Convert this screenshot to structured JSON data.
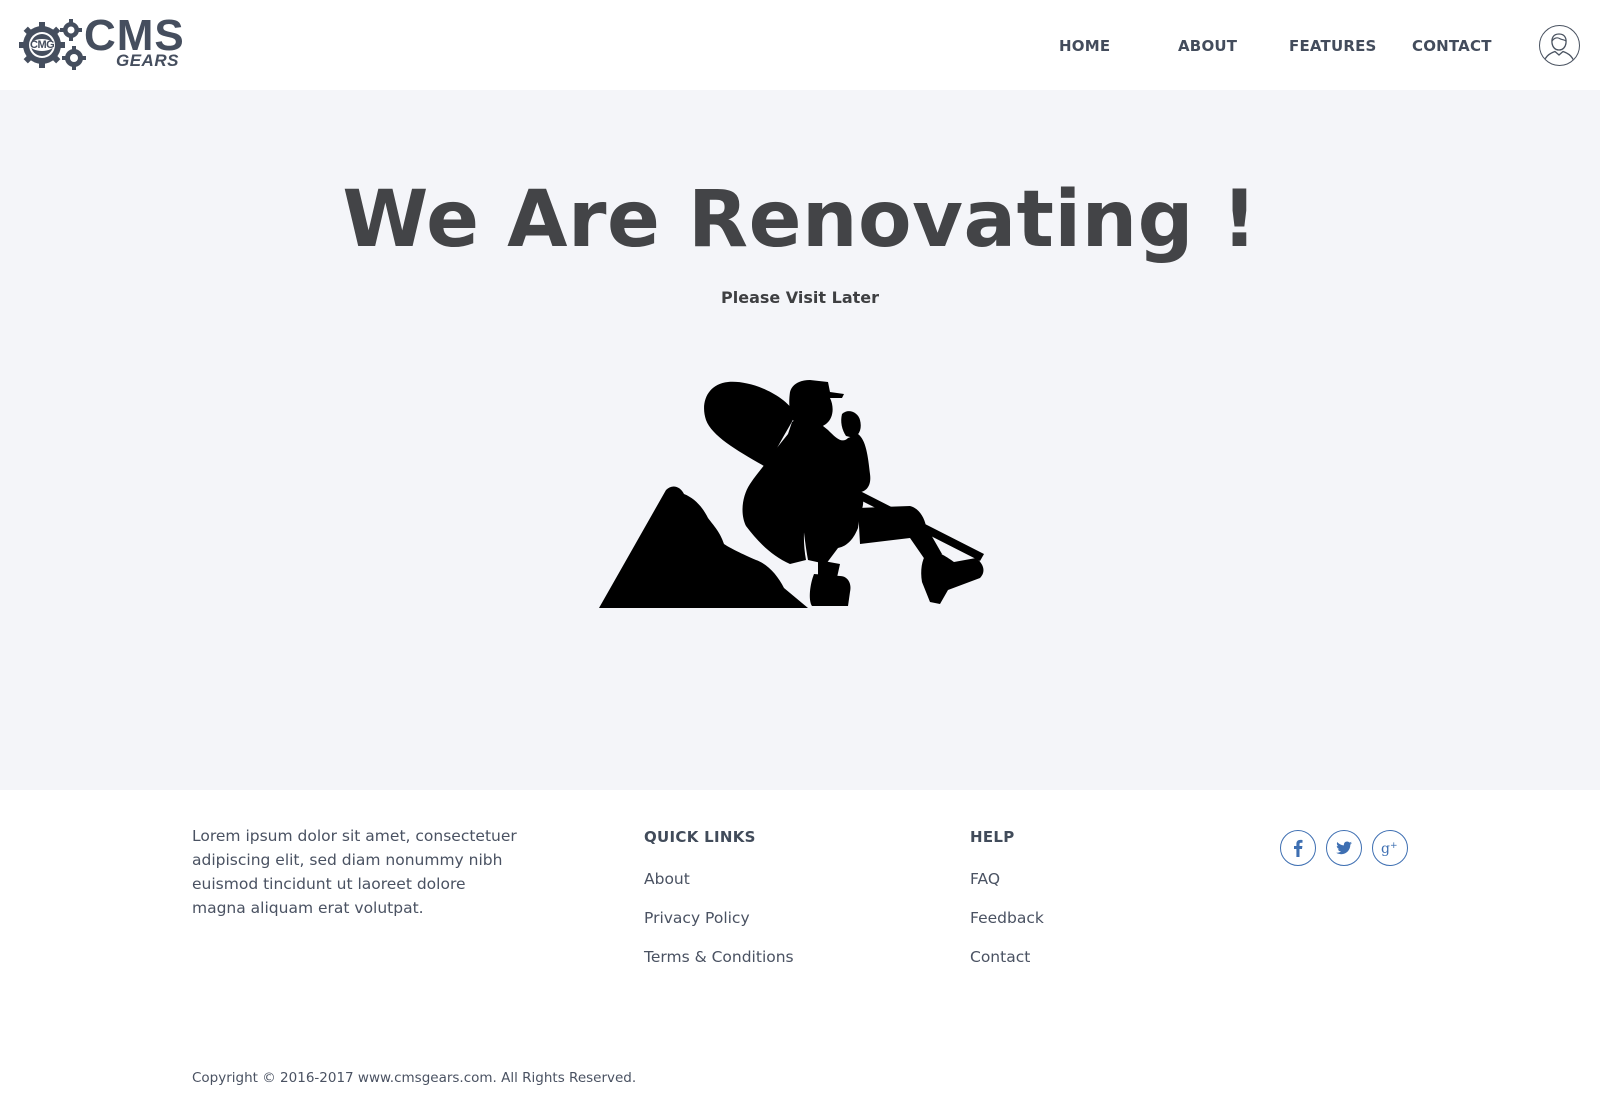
{
  "brand": {
    "name": "CMS",
    "tagline": "GEARS",
    "emblem_text": "CMG",
    "color": "#454e5e"
  },
  "nav": {
    "items": [
      {
        "label": "HOME"
      },
      {
        "label": "ABOUT"
      },
      {
        "label": "FEATURES"
      },
      {
        "label": "CONTACT"
      }
    ],
    "avatar_icon": "user-avatar-icon"
  },
  "hero": {
    "title": "We Are Renovating !",
    "subtitle": "Please Visit Later",
    "illustration": "worker-with-shovel-icon",
    "background": "#f4f5f9"
  },
  "footer": {
    "about": "Lorem ipsum dolor sit amet, consectetuer adipiscing elit, sed diam nonummy nibh euismod tincidunt ut laoreet dolore magna aliquam erat volutpat.",
    "quick_links": {
      "title": "QUICK LINKS",
      "links": [
        {
          "label": "About"
        },
        {
          "label": "Privacy Policy"
        },
        {
          "label": "Terms & Conditions"
        }
      ]
    },
    "help": {
      "title": "HELP",
      "links": [
        {
          "label": "FAQ"
        },
        {
          "label": "Feedback"
        },
        {
          "label": "Contact"
        }
      ]
    },
    "social": [
      {
        "icon": "facebook-icon"
      },
      {
        "icon": "twitter-icon"
      },
      {
        "icon": "google-plus-icon"
      }
    ],
    "social_color": "#3e6fb2",
    "copyright": "Copyright © 2016-2017 www.cmsgears.com. All Rights Reserved."
  }
}
